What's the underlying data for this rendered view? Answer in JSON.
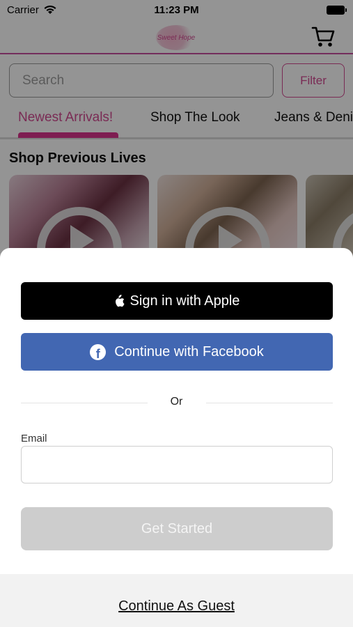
{
  "status_bar": {
    "carrier": "Carrier",
    "time": "11:23 PM"
  },
  "header": {
    "logo_text": "Sweet Hope",
    "cart_icon": "cart-icon"
  },
  "search": {
    "placeholder": "Search",
    "value": ""
  },
  "filter_label": "Filter",
  "tabs": [
    {
      "label": "Newest Arrivals!",
      "active": true
    },
    {
      "label": "Shop The Look",
      "active": false
    },
    {
      "label": "Jeans & Deni",
      "active": false
    }
  ],
  "section_title": "Shop Previous Lives",
  "sheet": {
    "apple_label": "Sign in with Apple",
    "facebook_label": "Continue with Facebook",
    "or_text": "Or",
    "email_label": "Email",
    "email_value": "",
    "get_started_label": "Get Started",
    "guest_label": "Continue As Guest"
  },
  "colors": {
    "brand_pink": "#d24a92",
    "facebook_blue": "#4267b2",
    "apple_black": "#000000",
    "disabled_gray": "#cdcdcd"
  }
}
